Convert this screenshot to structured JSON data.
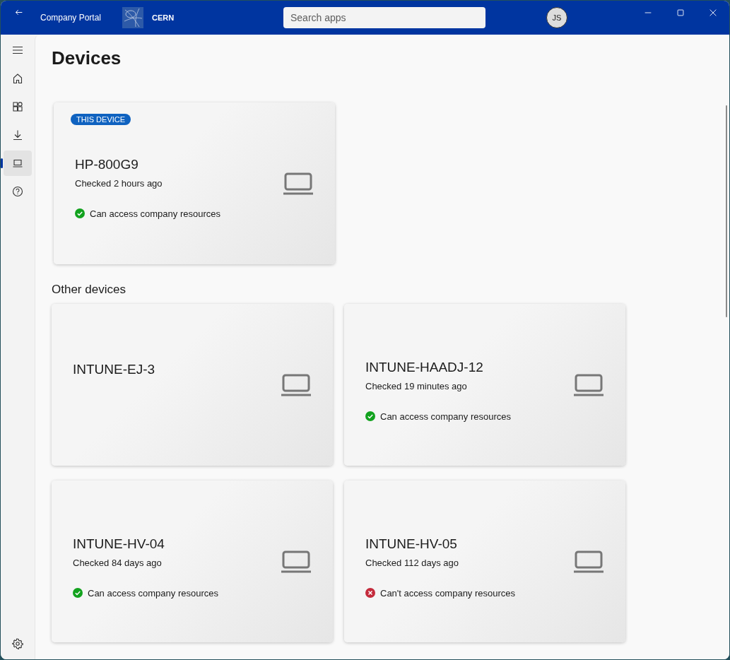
{
  "window": {
    "title": "Company Portal",
    "organization": "CERN"
  },
  "search": {
    "placeholder": "Search apps"
  },
  "account": {
    "initials": "JS"
  },
  "nav": [
    {
      "kind": "home",
      "selected": false
    },
    {
      "kind": "apps",
      "selected": false
    },
    {
      "kind": "downloads",
      "selected": false
    },
    {
      "kind": "devices",
      "selected": true
    },
    {
      "kind": "help",
      "selected": false
    }
  ],
  "page_title": "Devices",
  "this_device": {
    "badge": "THIS DEVICE",
    "name": "HP-800G9",
    "checked": "Checked 2 hours ago",
    "status": {
      "text": "Can access company resources",
      "ok": true
    }
  },
  "other_devices_heading": "Other devices",
  "other_devices": [
    {
      "name": "INTUNE-EJ-3"
    },
    {
      "name": "INTUNE-HAADJ-12",
      "checked": "Checked 19 minutes ago",
      "status": {
        "text": "Can access company resources",
        "ok": true
      }
    },
    {
      "name": "INTUNE-HV-04",
      "checked": "Checked 84 days ago",
      "status": {
        "text": "Can access company resources",
        "ok": true
      }
    },
    {
      "name": "INTUNE-HV-05",
      "checked": "Checked 112 days ago",
      "status": {
        "text": "Can't access company resources",
        "ok": false
      }
    }
  ]
}
